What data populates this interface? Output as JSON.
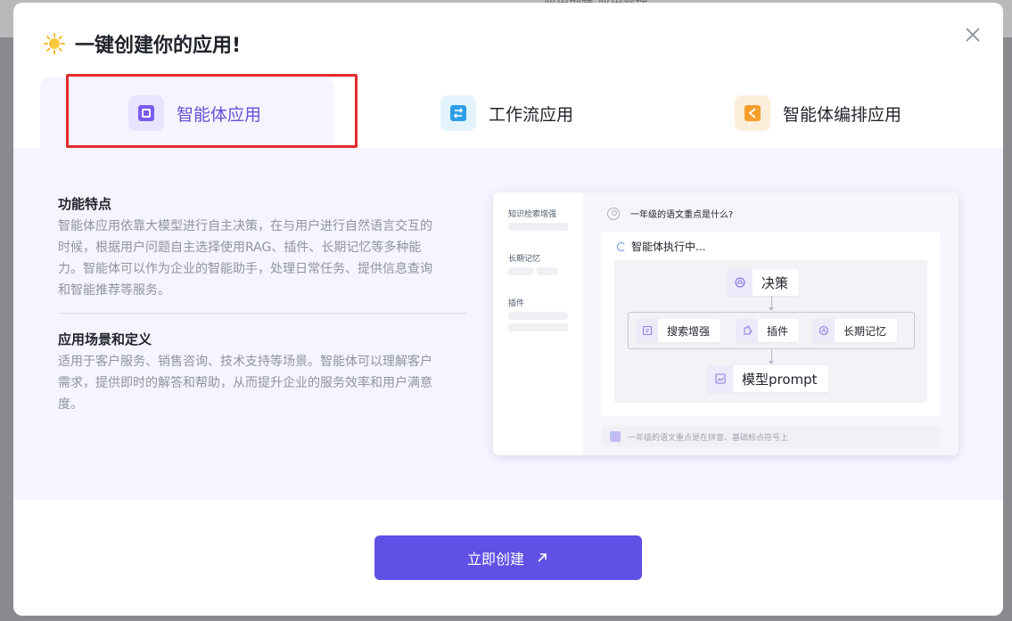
{
  "background": {
    "tabs_partial": "应用创建  应用管理"
  },
  "modal": {
    "title": "一键创建你的应用!",
    "icons": {
      "title": "sun-icon",
      "close": "close-icon"
    }
  },
  "tabs": [
    {
      "label": "智能体应用",
      "icon": "agent-app-icon",
      "active": true,
      "accent": "#6b4fd8"
    },
    {
      "label": "工作流应用",
      "icon": "workflow-app-icon",
      "active": false,
      "accent": "#2f9ee8"
    },
    {
      "label": "智能体编排应用",
      "icon": "orchestration-app-icon",
      "active": false,
      "accent": "#f59e2c"
    }
  ],
  "content": {
    "features_title": "功能特点",
    "features_body_lines": [
      "智能体应用依靠大模型进行自主决策，在与用户进行自然语言交互的",
      "时候，根据用户问题自主选择使用RAG、插件、长期记忆等多种能",
      "力。智能体可以作为企业的智能助手，处理日常任务、提供信息查询",
      "和智能推荐等服务。"
    ],
    "scenarios_title": "应用场景和定义",
    "scenarios_body_lines": [
      "适用于客户服务、销售咨询、技术支持等场景。智能体可以理解客户",
      "需求，提供即时的解答和帮助，从而提升企业的服务效率和用户满意",
      "度。"
    ]
  },
  "preview": {
    "sidebar": [
      "知识检索增强",
      "长期记忆",
      "插件"
    ],
    "question": "一年级的语文重点是什么?",
    "executing": "智能体执行中...",
    "nodes": {
      "decision": "决策",
      "search": "搜索增强",
      "plugin": "插件",
      "memory": "长期记忆",
      "model": "模型prompt"
    },
    "answer": "一年级的语文重点是在拼音、基础标点符号上"
  },
  "actions": {
    "create_label": "立即创建",
    "create_icon": "arrow-up-right-icon",
    "button_color": "#6050e6"
  },
  "annotation": {
    "highlight_color": "#e32b2b"
  }
}
